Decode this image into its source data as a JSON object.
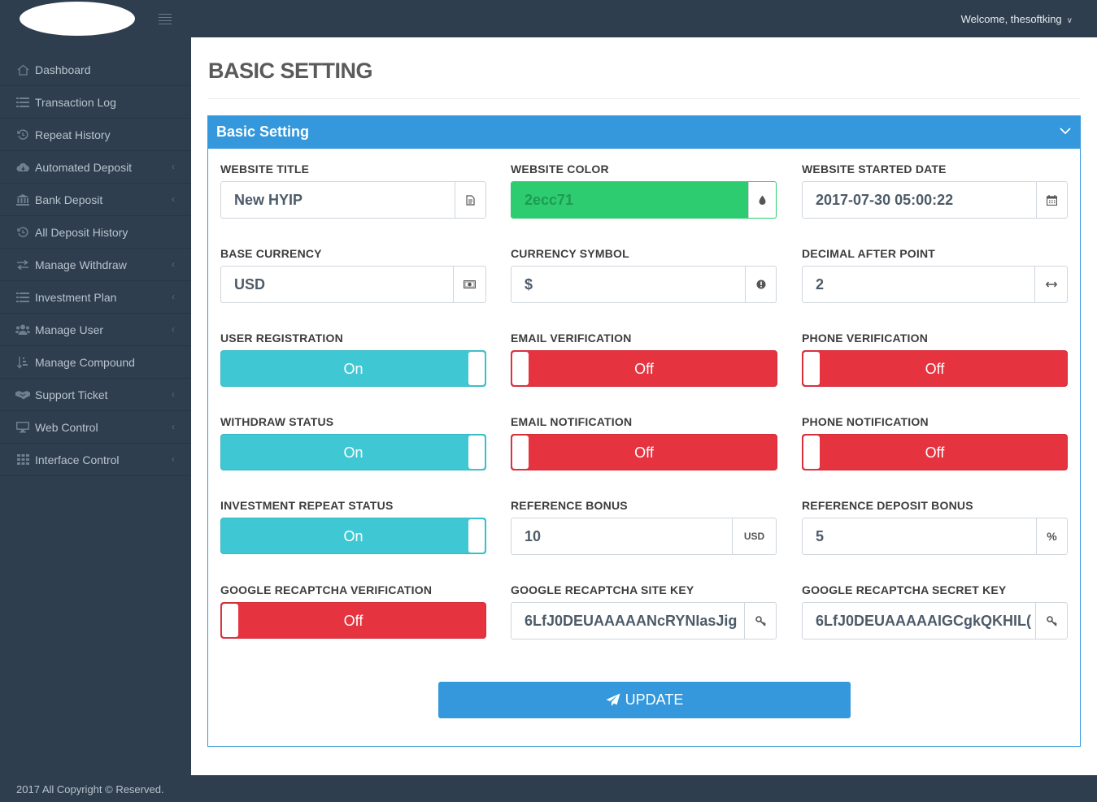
{
  "header": {
    "welcome": "Welcome, thesoftking"
  },
  "sidebar": {
    "items": [
      {
        "label": "Dashboard",
        "icon": "home-icon",
        "has_submenu": false
      },
      {
        "label": "Transaction Log",
        "icon": "list-icon",
        "has_submenu": false
      },
      {
        "label": "Repeat History",
        "icon": "history-icon",
        "has_submenu": false
      },
      {
        "label": "Automated Deposit",
        "icon": "cloud-download-icon",
        "has_submenu": true
      },
      {
        "label": "Bank Deposit",
        "icon": "bank-icon",
        "has_submenu": true
      },
      {
        "label": "All Deposit History",
        "icon": "history-icon",
        "has_submenu": false
      },
      {
        "label": "Manage Withdraw",
        "icon": "exchange-icon",
        "has_submenu": true
      },
      {
        "label": "Investment Plan",
        "icon": "list-icon",
        "has_submenu": true
      },
      {
        "label": "Manage User",
        "icon": "users-icon",
        "has_submenu": true
      },
      {
        "label": "Manage Compound",
        "icon": "sort-icon",
        "has_submenu": false
      },
      {
        "label": "Support Ticket",
        "icon": "handshake-icon",
        "has_submenu": true
      },
      {
        "label": "Web Control",
        "icon": "desktop-icon",
        "has_submenu": true
      },
      {
        "label": "Interface Control",
        "icon": "grid-icon",
        "has_submenu": true
      }
    ]
  },
  "page": {
    "title": "BASIC SETTING",
    "panel_title": "Basic Setting"
  },
  "fields": {
    "website_title": {
      "label": "WEBSITE TITLE",
      "value": "New HYIP",
      "icon": "file-icon"
    },
    "website_color": {
      "label": "WEBSITE COLOR",
      "value": "2ecc71",
      "icon": "tint-icon",
      "color": "#2ecc71"
    },
    "website_started_date": {
      "label": "WEBSITE STARTED DATE",
      "value": "2017-07-30 05:00:22",
      "icon": "calendar-icon"
    },
    "base_currency": {
      "label": "BASE CURRENCY",
      "value": "USD",
      "icon": "money-icon"
    },
    "currency_symbol": {
      "label": "CURRENCY SYMBOL",
      "value": "$",
      "icon": "exclamation-icon"
    },
    "decimal_after_point": {
      "label": "DECIMAL AFTER POINT",
      "value": "2",
      "icon": "arrows-h-icon"
    },
    "user_registration": {
      "label": "USER REGISTRATION",
      "state": "On"
    },
    "email_verification": {
      "label": "EMAIL VERIFICATION",
      "state": "Off"
    },
    "phone_verification": {
      "label": "PHONE VERIFICATION",
      "state": "Off"
    },
    "withdraw_status": {
      "label": "WITHDRAW STATUS",
      "state": "On"
    },
    "email_notification": {
      "label": "EMAIL NOTIFICATION",
      "state": "Off"
    },
    "phone_notification": {
      "label": "PHONE NOTIFICATION",
      "state": "Off"
    },
    "investment_repeat_status": {
      "label": "INVESTMENT REPEAT STATUS",
      "state": "On"
    },
    "reference_bonus": {
      "label": "REFERENCE BONUS",
      "value": "10",
      "addon": "USD"
    },
    "reference_deposit_bonus": {
      "label": "REFERENCE DEPOSIT BONUS",
      "value": "5",
      "addon": "%"
    },
    "google_recaptcha_verification": {
      "label": "GOOGLE RECAPTCHA VERIFICATION",
      "state": "Off"
    },
    "google_recaptcha_site_key": {
      "label": "GOOGLE RECAPTCHA SITE KEY",
      "value": "6LfJ0DEUAAAAANcRYNIasJig",
      "icon": "key-icon"
    },
    "google_recaptcha_secret_key": {
      "label": "GOOGLE RECAPTCHA SECRET KEY",
      "value": "6LfJ0DEUAAAAAIGCgkQKHIL(",
      "icon": "key-icon"
    }
  },
  "actions": {
    "update_label": "UPDATE"
  },
  "footer": {
    "copyright": "2017 All Copyright © Reserved."
  },
  "colors": {
    "sidebar_bg": "#2f3e4e",
    "accent": "#3598dc",
    "toggle_on": "#3fc8d4",
    "toggle_off": "#e53340",
    "website_color": "#2ecc71"
  }
}
